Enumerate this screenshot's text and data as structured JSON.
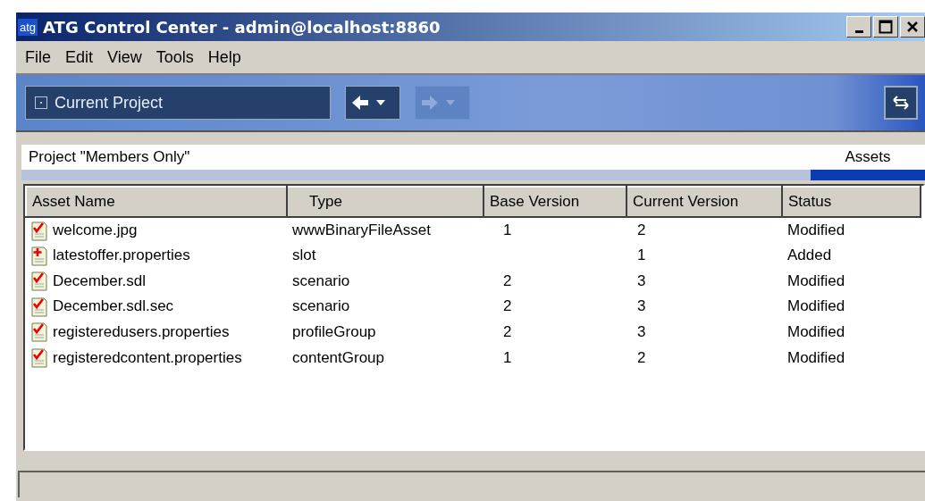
{
  "window": {
    "title": "ATG Control Center - admin@localhost:8860",
    "app_badge": "atg"
  },
  "menu": [
    "File",
    "Edit",
    "View",
    "Tools",
    "Help"
  ],
  "toolbar": {
    "project_field": "Current Project",
    "nav_buttons": [
      {
        "kind": "back",
        "disabled": false
      },
      {
        "kind": "forward",
        "disabled": true
      }
    ]
  },
  "project_title": "Project \"Members Only\"",
  "view_tab": {
    "label": "Assets",
    "selected": true
  },
  "table": {
    "columns": [
      "Asset Name",
      "Type",
      "Base Version",
      "Current Version",
      "Status"
    ],
    "rows": [
      {
        "kind": "modified",
        "cells": [
          "welcome.jpg",
          "wwwBinaryFileAsset",
          "1",
          "2",
          "Modified"
        ]
      },
      {
        "kind": "added",
        "cells": [
          "latestoffer.properties",
          "slot",
          "",
          "1",
          "Added"
        ]
      },
      {
        "kind": "modified",
        "cells": [
          "December.sdl",
          "scenario",
          "2",
          "3",
          "Modified"
        ]
      },
      {
        "kind": "modified",
        "cells": [
          "December.sdl.sec",
          "scenario",
          "2",
          "3",
          "Modified"
        ]
      },
      {
        "kind": "modified",
        "cells": [
          "registeredusers.properties",
          "profileGroup",
          "2",
          "3",
          "Modified"
        ]
      },
      {
        "kind": "modified",
        "cells": [
          "registeredcontent.properties",
          "contentGroup",
          "1",
          "2",
          "Modified"
        ]
      }
    ]
  }
}
